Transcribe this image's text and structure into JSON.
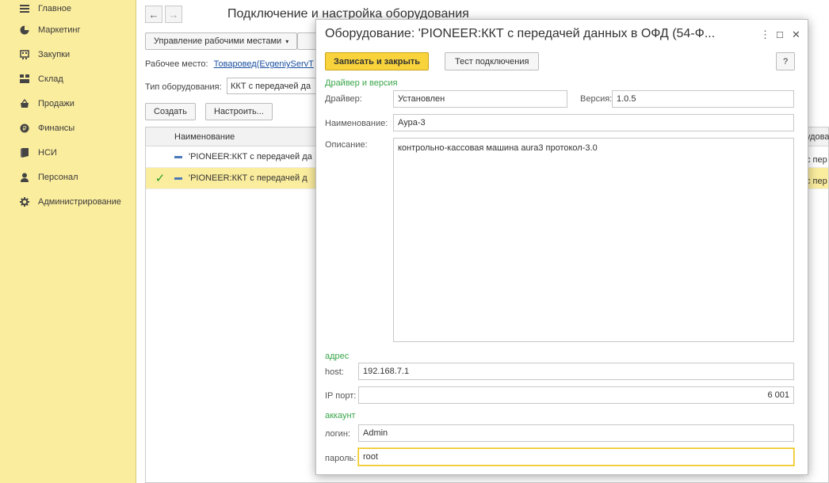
{
  "sidebar": {
    "items": [
      {
        "label": "Главное",
        "icon": "menu-icon"
      },
      {
        "label": "Маркетинг",
        "icon": "marketing-icon"
      },
      {
        "label": "Закупки",
        "icon": "purchases-icon"
      },
      {
        "label": "Склад",
        "icon": "warehouse-icon"
      },
      {
        "label": "Продажи",
        "icon": "sales-icon"
      },
      {
        "label": "Финансы",
        "icon": "finance-icon"
      },
      {
        "label": "НСИ",
        "icon": "reference-icon"
      },
      {
        "label": "Персонал",
        "icon": "personnel-icon"
      },
      {
        "label": "Администрирование",
        "icon": "gear-icon"
      }
    ]
  },
  "main": {
    "title": "Подключение и настройка оборудования",
    "workplaces_button": "Управление рабочими местами",
    "workplace_label": "Рабочее место:",
    "workplace_value": "Товаровед(EvgeniyServT",
    "equipment_type_label": "Тип оборудования:",
    "equipment_type_value": "ККТ с передачей да",
    "create_button": "Создать",
    "configure_button": "Настроить...",
    "list": {
      "header": "Наименование",
      "header_right": "удова",
      "rows": [
        {
          "name": "'PIONEER:ККТ с передачей да",
          "right": "с пер",
          "selected": false
        },
        {
          "name": "'PIONEER:ККТ с передачей д",
          "right": "с пер",
          "selected": true
        }
      ]
    }
  },
  "modal": {
    "title": "Оборудование: 'PIONEER:ККТ с передачей данных в ОФД (54-Ф...",
    "save_close": "Записать и закрыть",
    "test_connection": "Тест подключения",
    "help": "?",
    "driver_group": "Драйвер и версия",
    "driver_label": "Драйвер:",
    "driver_value": "Установлен",
    "version_label": "Версия:",
    "version_value": "1.0.5",
    "name_label": "Наименование:",
    "name_value": "Аура-3",
    "description_label": "Описание:",
    "description_value": "контрольно-кассовая машина aura3 протокол-3.0",
    "address_group": "адрес",
    "host_label": "host:",
    "host_value": "192.168.7.1",
    "port_label": "IP порт:",
    "port_value": "6 001",
    "account_group": "аккаунт",
    "login_label": "логин:",
    "login_value": "Admin",
    "password_label": "пароль:",
    "password_value": "root"
  }
}
